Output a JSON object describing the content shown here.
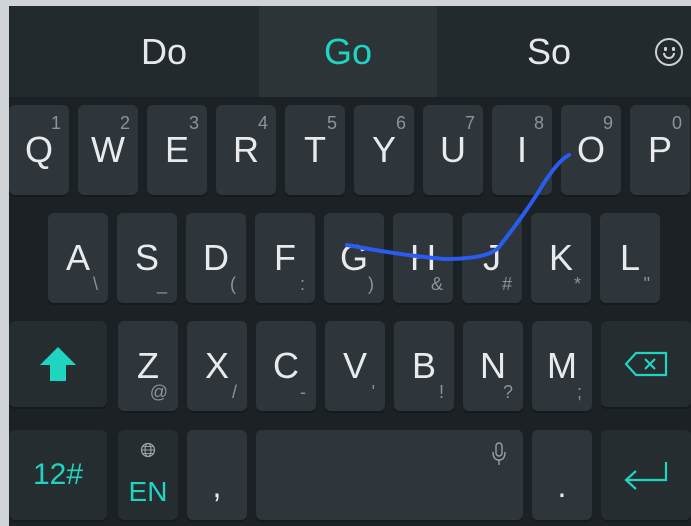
{
  "suggestions": [
    "Do",
    "Go",
    "So"
  ],
  "row1": [
    {
      "letter": "Q",
      "num": "1"
    },
    {
      "letter": "W",
      "num": "2"
    },
    {
      "letter": "E",
      "num": "3"
    },
    {
      "letter": "R",
      "num": "4"
    },
    {
      "letter": "T",
      "num": "5"
    },
    {
      "letter": "Y",
      "num": "6"
    },
    {
      "letter": "U",
      "num": "7"
    },
    {
      "letter": "I",
      "num": "8"
    },
    {
      "letter": "O",
      "num": "9"
    },
    {
      "letter": "P",
      "num": "0"
    }
  ],
  "row2": [
    {
      "letter": "A",
      "sub": "\\"
    },
    {
      "letter": "S",
      "sub": "_"
    },
    {
      "letter": "D",
      "sub": "("
    },
    {
      "letter": "F",
      "sub": ":"
    },
    {
      "letter": "G",
      "sub": ")"
    },
    {
      "letter": "H",
      "sub": "&"
    },
    {
      "letter": "J",
      "sub": "#"
    },
    {
      "letter": "K",
      "sub": "*"
    },
    {
      "letter": "L",
      "sub": "\""
    }
  ],
  "row3": [
    {
      "letter": "Z",
      "sub": "@"
    },
    {
      "letter": "X",
      "sub": "/"
    },
    {
      "letter": "C",
      "sub": "-"
    },
    {
      "letter": "V",
      "sub": "'"
    },
    {
      "letter": "B",
      "sub": "!"
    },
    {
      "letter": "N",
      "sub": "?"
    },
    {
      "letter": "M",
      "sub": ";"
    }
  ],
  "bottom": {
    "symbols_label": "12#",
    "language_label": "EN",
    "comma_label": ",",
    "period_label": "."
  },
  "colors": {
    "accent": "#20d5c0",
    "swipe_trail": "#2a5cf0"
  },
  "icons": {
    "shift": "shift-icon",
    "backspace": "backspace-icon",
    "enter": "enter-icon",
    "mic": "microphone-icon",
    "globe": "globe-icon",
    "emoji": "emoji-icon"
  }
}
